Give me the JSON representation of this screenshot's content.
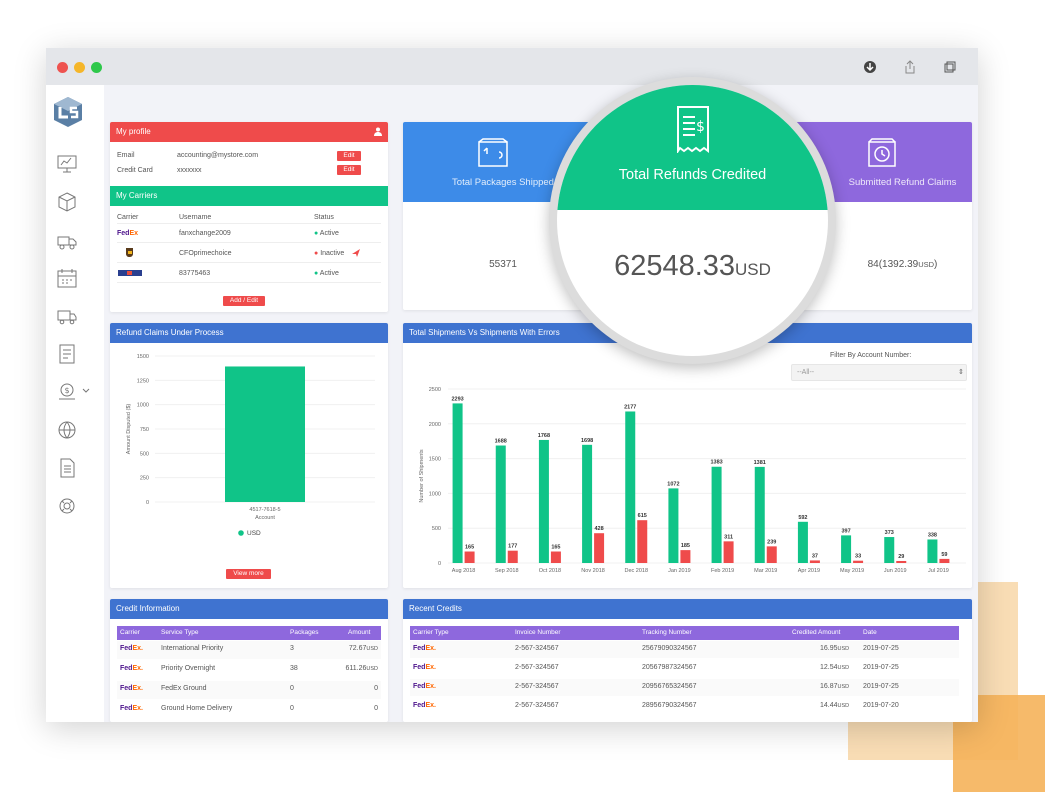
{
  "colors": {
    "red": "#ef4b4b",
    "green": "#10c488",
    "blue": "#3f73d0",
    "purple": "#8e68dd",
    "bar_green": "#10c488",
    "bar_red": "#ef4b4b",
    "deco_orange": "#f5b25a"
  },
  "icons": [
    "download-icon",
    "share-icon",
    "duplicate-icon",
    "dashboard-icon",
    "package-icon",
    "delivery-icon",
    "calendar-icon",
    "truck-icon",
    "report-icon",
    "refund-icon",
    "globe-icon",
    "document-icon",
    "support-icon",
    "receipt-icon",
    "box-icon",
    "clock-icon",
    "user-icon",
    "plane-icon"
  ],
  "profile": {
    "title": "My profile",
    "rows": [
      {
        "label": "Email",
        "value": "accounting@mystore.com",
        "action": "Edit"
      },
      {
        "label": "Credit Card",
        "value": "xxxxxxx",
        "action": "Edit"
      }
    ]
  },
  "carriers": {
    "title": "My Carriers",
    "headers": [
      "Carrier",
      "Username",
      "Status"
    ],
    "rows": [
      {
        "carrier": "FedEx",
        "username": "fanxchange2009",
        "status": "Active"
      },
      {
        "carrier": "UPS",
        "username": "CFOprimechoice",
        "status": "Inactive"
      },
      {
        "carrier": "USPS",
        "username": "83775463",
        "status": "Active"
      }
    ],
    "button": "Add / Edit"
  },
  "stats": {
    "packages": {
      "label": "Total Packages Shipped",
      "value": "55371"
    },
    "refunds": {
      "label": "Total Refunds Credited",
      "value": "62548.33",
      "unit": "USD"
    },
    "claims": {
      "label": "Submitted Refund Claims",
      "value": "84(1392.39",
      "unit": "USD",
      "close": ")"
    }
  },
  "refund_claims": {
    "title": "Refund Claims Under Process",
    "button": "View more"
  },
  "shipments": {
    "title": "Total Shipments Vs Shipments With Errors",
    "filter_label": "Filter By Account Number:",
    "filter_value": "--All--"
  },
  "chart_data": [
    {
      "type": "bar",
      "title": "",
      "categories": [
        "4517-7618-5"
      ],
      "series": [
        {
          "name": "USD",
          "values": [
            1392.39
          ]
        }
      ],
      "xlabel": "Account",
      "ylabel": "Amount Disputed ($)",
      "ylim": [
        0,
        1500
      ],
      "yticks": [
        "1500",
        "1250",
        "1000",
        "750",
        "500",
        "250",
        "0"
      ],
      "legend": "bottom"
    },
    {
      "type": "bar",
      "title": "",
      "categories": [
        "Aug 2018",
        "Sep 2018",
        "Oct 2018",
        "Nov 2018",
        "Dec 2018",
        "Jan 2019",
        "Feb 2019",
        "Mar 2019",
        "Apr 2019",
        "May 2019",
        "Jun 2019",
        "Jul 2019"
      ],
      "series": [
        {
          "values": [
            2293,
            1688,
            1768,
            1698,
            2177,
            1072,
            1383,
            1381,
            592,
            397,
            373,
            338
          ]
        },
        {
          "values": [
            165,
            177,
            165,
            428,
            615,
            185,
            311,
            239,
            37,
            33,
            29,
            59
          ]
        }
      ],
      "value_labels": [
        [
          "2293",
          "1688",
          "1768",
          "1698",
          "2177",
          "1072",
          "1383",
          "1381",
          "592",
          "397",
          "373",
          "338"
        ],
        [
          "165",
          "177",
          "165",
          "428",
          "615",
          "185",
          "311",
          "239",
          "37",
          "33",
          "29",
          "59"
        ]
      ],
      "xlabel": "",
      "ylabel": "Number of Shipments",
      "ylim": [
        0,
        2500
      ],
      "yticks": [
        "2500",
        "2000",
        "1500",
        "1000",
        "500",
        "0"
      ],
      "grid": true
    }
  ],
  "credit_info": {
    "title": "Credit Information",
    "headers": [
      "Carrier",
      "Service Type",
      "Packages",
      "Amount"
    ],
    "rows": [
      {
        "carrier": "FedEx",
        "service": "International Priority",
        "packages": "3",
        "amount": "72.67",
        "unit": "USD"
      },
      {
        "carrier": "FedEx",
        "service": "Priority Overnight",
        "packages": "38",
        "amount": "611.26",
        "unit": "USD"
      },
      {
        "carrier": "FedEx",
        "service": "FedEx Ground",
        "packages": "0",
        "amount": "0",
        "unit": ""
      },
      {
        "carrier": "FedEx",
        "service": "Ground Home Delivery",
        "packages": "0",
        "amount": "0",
        "unit": ""
      }
    ]
  },
  "recent_credits": {
    "title": "Recent Credits",
    "headers": [
      "Carrier Type",
      "Invoice Number",
      "Tracking Number",
      "Credited Amount",
      "Date"
    ],
    "rows": [
      {
        "carrier": "FedEx",
        "invoice": "2-567-324567",
        "tracking": "25679090324567",
        "amount": "16.95",
        "unit": "USD",
        "date": "2019-07-25"
      },
      {
        "carrier": "FedEx",
        "invoice": "2-567-324567",
        "tracking": "20567987324567",
        "amount": "12.54",
        "unit": "USD",
        "date": "2019-07-25"
      },
      {
        "carrier": "FedEx",
        "invoice": "2-567-324567",
        "tracking": "20956765324567",
        "amount": "16.87",
        "unit": "USD",
        "date": "2019-07-25"
      },
      {
        "carrier": "FedEx",
        "invoice": "2-567-324567",
        "tracking": "28956790324567",
        "amount": "14.44",
        "unit": "USD",
        "date": "2019-07-20"
      }
    ]
  },
  "fedex_parts": {
    "fe": "Fed",
    "ex": "Ex",
    "dot": "."
  }
}
